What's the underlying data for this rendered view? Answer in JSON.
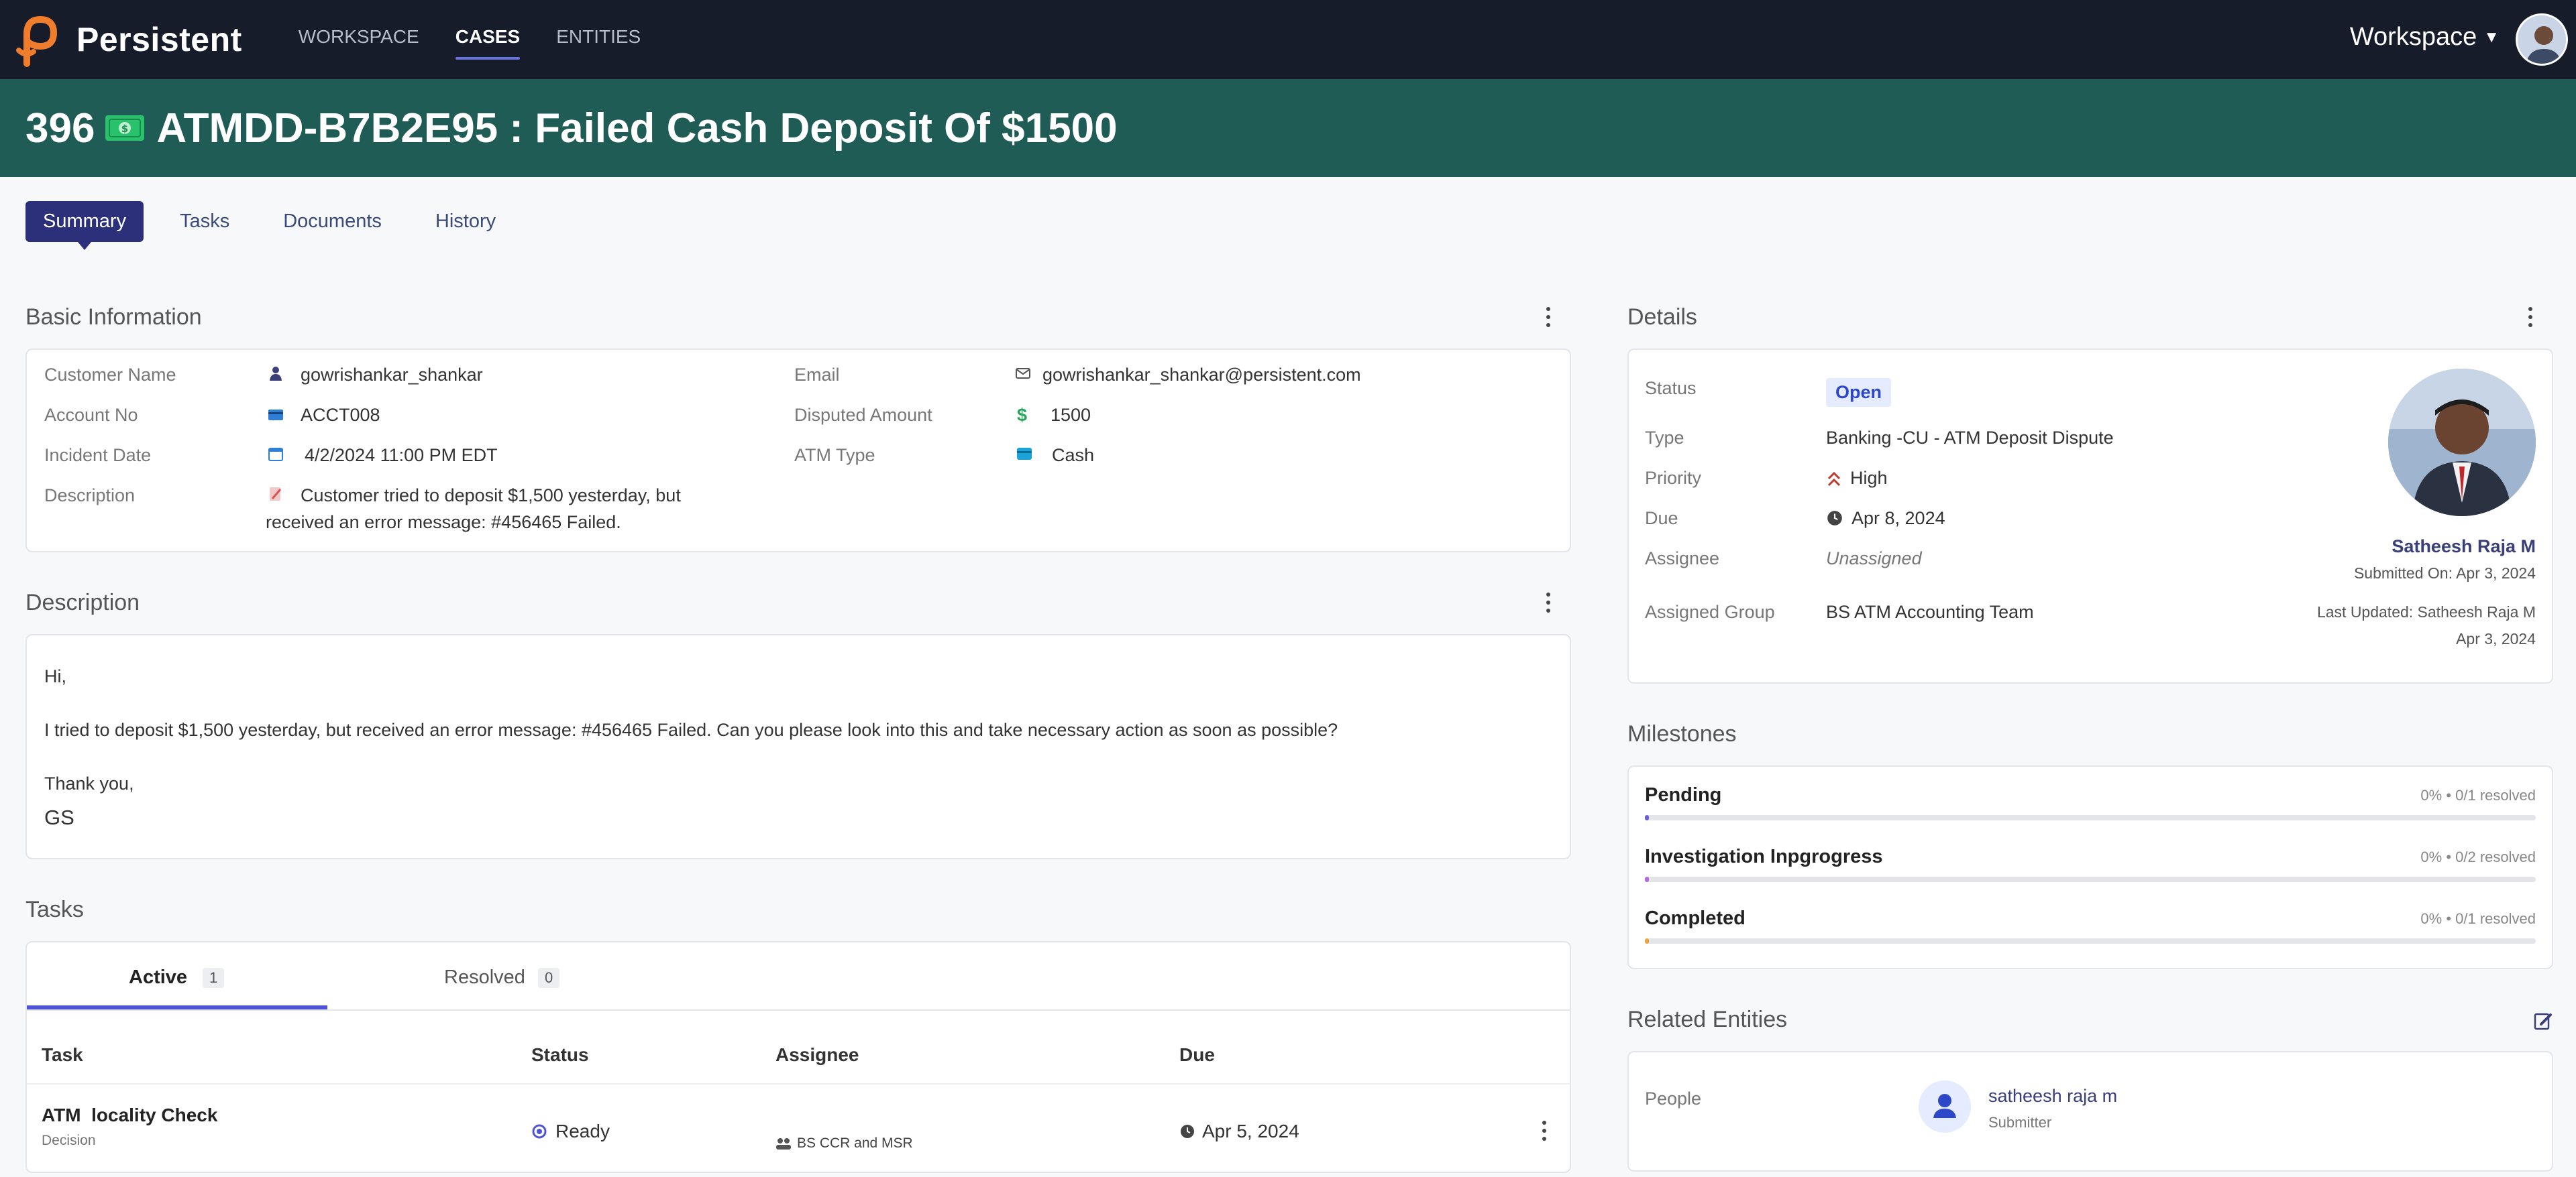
{
  "app": {
    "brand": "Persistent",
    "nav": [
      "WORKSPACE",
      "CASES",
      "ENTITIES"
    ],
    "workspace_label": "Workspace"
  },
  "case": {
    "number": "396",
    "title": "ATMDD-B7B2E95 : Failed Cash Deposit Of $1500"
  },
  "tabs": [
    "Summary",
    "Tasks",
    "Documents",
    "History"
  ],
  "basic_info": {
    "title": "Basic Information",
    "customer_name_label": "Customer Name",
    "customer_name": "gowrishankar_shankar",
    "account_label": "Account No",
    "account": "ACCT008",
    "incident_label": "Incident Date",
    "incident": "4/2/2024 11:00 PM EDT",
    "description_label": "Description",
    "description_line1": "Customer tried to deposit $1,500 yesterday, but",
    "description_line2": "received an error message: #456465 Failed.",
    "email_label": "Email",
    "email": "gowrishankar_shankar@persistent.com",
    "amount_label": "Disputed Amount",
    "amount": "1500",
    "atm_type_label": "ATM Type",
    "atm_type": "Cash"
  },
  "description": {
    "title": "Description",
    "greeting": "Hi,",
    "body": "I tried to deposit $1,500 yesterday, but received an error message: #456465 Failed. Can you please look into this and take necessary action as soon as possible?",
    "signoff": "Thank you,",
    "signature": "GS"
  },
  "tasks": {
    "title": "Tasks",
    "tab_active": "Active",
    "tab_active_count": "1",
    "tab_resolved": "Resolved",
    "tab_resolved_count": "0",
    "columns": [
      "Task",
      "Status",
      "Assignee",
      "Due"
    ],
    "rows": [
      {
        "name": "ATM  locality Check",
        "type": "Decision",
        "status": "Ready",
        "assignee": "BS CCR and MSR",
        "due": "Apr 5, 2024"
      }
    ]
  },
  "details": {
    "title": "Details",
    "status_label": "Status",
    "status": "Open",
    "type_label": "Type",
    "type": "Banking -CU - ATM Deposit Dispute",
    "priority_label": "Priority",
    "priority": "High",
    "due_label": "Due",
    "due": "Apr 8, 2024",
    "assignee_label": "Assignee",
    "assignee": "Unassigned",
    "group_label": "Assigned Group",
    "group": "BS ATM Accounting Team",
    "submitter_name": "Satheesh Raja M",
    "submitted_on": "Submitted On: Apr 3, 2024",
    "last_updated": "Last Updated: Satheesh Raja M",
    "last_updated_date": "Apr 3, 2024"
  },
  "milestones": {
    "title": "Milestones",
    "items": [
      {
        "name": "Pending",
        "meta": "0% • 0/1 resolved",
        "progress": 0,
        "color": "#6b5bd6"
      },
      {
        "name": "Investigation Inpgrogress",
        "meta": "0% • 0/2 resolved",
        "progress": 0,
        "color": "#b06be0"
      },
      {
        "name": "Completed",
        "meta": "0% • 0/1 resolved",
        "progress": 0,
        "color": "#e8a33a"
      }
    ]
  },
  "related": {
    "title": "Related Entities",
    "people_label": "People",
    "person_name": "satheesh raja m",
    "person_role": "Submitter"
  },
  "colors": {
    "topbar": "#171c2a",
    "header": "#1f5c55",
    "accent": "#2c2f7a",
    "link": "#4d55d6"
  }
}
